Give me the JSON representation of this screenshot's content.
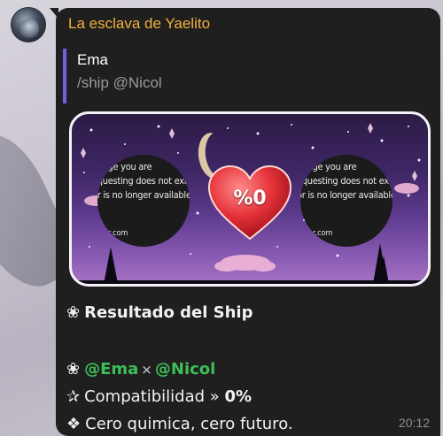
{
  "chat": {
    "sender": "La esclava de Yaelito",
    "reply": {
      "author": "Ema",
      "text": "/ship @Nicol"
    },
    "card": {
      "left_placeholder": [
        "image you are",
        "equesting does not exis",
        "or is no longer available."
      ],
      "left_domain": "r.com",
      "right_placeholder": [
        "image you are",
        "equesting does not exis",
        "or is no longer available."
      ],
      "right_domain": "r.com",
      "score": "%0",
      "heart_color": "#e5333a"
    },
    "result": {
      "title_glyph": "❀",
      "title": "Resultado del Ship",
      "ship_glyph": "❀",
      "user_a": "@Ema",
      "times": "×",
      "user_b": "@Nicol",
      "compat_glyph": "✰",
      "compat_label": "Compatibilidad »",
      "compat_value": "0%",
      "final_glyph": "❖",
      "final_text": "Cero quimica, cero futuro."
    },
    "time": "20:12"
  },
  "colors": {
    "bubble": "#1f1f1f",
    "sender": "#f2b13d",
    "reply_bar": "#7a5ce0",
    "mention": "#3dbf58"
  }
}
